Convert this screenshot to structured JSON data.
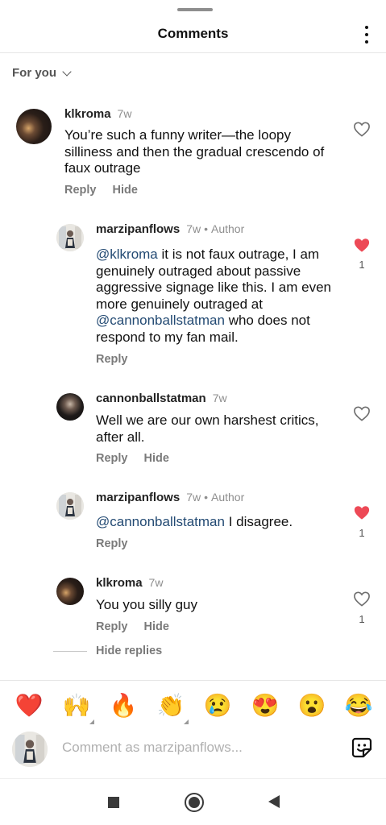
{
  "header": {
    "title": "Comments"
  },
  "filter": {
    "label": "For you"
  },
  "comments": [
    {
      "user": "klkroma",
      "time": "7w",
      "author_badge": "",
      "text_parts": [
        "You’re such a funny writer—the loopy silliness and then the gradual crescendo of faux outrage"
      ],
      "reply": "Reply",
      "hide": "Hide",
      "liked": false,
      "likes": ""
    },
    {
      "user": "marzipanflows",
      "time": "7w",
      "author_badge": "Author",
      "mention1": "@klkroma",
      "text1": " it is not faux outrage, I am genuinely outraged about passive aggressive signage like this. I am even more genuinely outraged at ",
      "mention2": "@cannonballstatman",
      "text2": " who does not respond to my fan mail.",
      "reply": "Reply",
      "liked": true,
      "likes": "1"
    },
    {
      "user": "cannonballstatman",
      "time": "7w",
      "text": "Well we are our own harshest critics, after all.",
      "reply": "Reply",
      "hide": "Hide",
      "liked": false,
      "likes": ""
    },
    {
      "user": "marzipanflows",
      "time": "7w",
      "author_badge": "Author",
      "mention1": "@cannonballstatman",
      "text1": " I disagree.",
      "reply": "Reply",
      "liked": true,
      "likes": "1"
    },
    {
      "user": "klkroma",
      "time": "7w",
      "text": "You you silly guy",
      "reply": "Reply",
      "hide": "Hide",
      "liked": false,
      "likes": "1"
    }
  ],
  "hide_replies": "Hide replies",
  "emoji_bar": [
    "❤️",
    "🙌",
    "🔥",
    "👏",
    "😢",
    "😍",
    "😮",
    "😂"
  ],
  "composer": {
    "placeholder": "Comment as marzipanflows..."
  },
  "colors": {
    "like_red": "#ed4956",
    "mention_blue": "#234a73"
  },
  "icons": {
    "more": "more-vertical-icon",
    "heart": "heart-icon",
    "sticker": "sticker-icon"
  }
}
